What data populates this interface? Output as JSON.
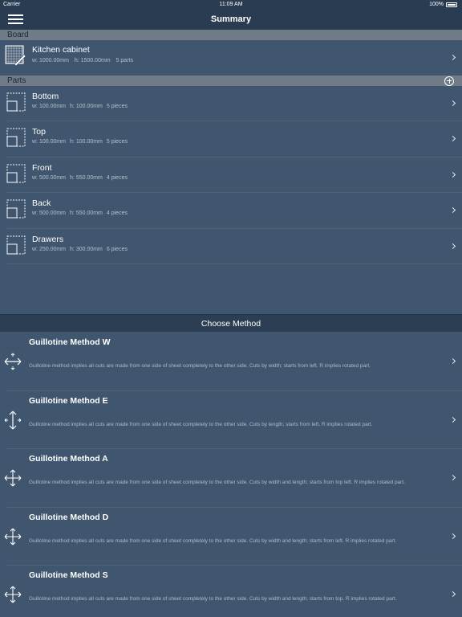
{
  "status": {
    "carrier": "Carrier",
    "time": "11:09 AM",
    "battery": "100%"
  },
  "nav": {
    "title": "Summary"
  },
  "board": {
    "header": "Board",
    "name": "Kitchen cabinet",
    "width": "w: 1000.00mm",
    "height": "h: 1500.00mm",
    "count": "5 parts"
  },
  "parts": {
    "header": "Parts",
    "items": [
      {
        "name": "Bottom",
        "width": "w: 100.00mm",
        "height": "h: 100.00mm",
        "count": "5 pieces"
      },
      {
        "name": "Top",
        "width": "w: 100.00mm",
        "height": "h: 100.00mm",
        "count": "5 pieces"
      },
      {
        "name": "Front",
        "width": "w: 500.00mm",
        "height": "h: 550.00mm",
        "count": "4 pieces"
      },
      {
        "name": "Back",
        "width": "w: 500.00mm",
        "height": "h: 550.00mm",
        "count": "4 pieces"
      },
      {
        "name": "Drawers",
        "width": "w: 250.00mm",
        "height": "h: 300.00mm",
        "count": "6 pieces"
      }
    ]
  },
  "methods": {
    "header": "Choose Method",
    "items": [
      {
        "name": "Guillotine Method W",
        "icon": "arrows-horizontal-icon",
        "desc": "Guillotine method implies all cuts are made from one side of sheet completely to the other side. Cuts by width; starts from left. R implies rotated part."
      },
      {
        "name": "Guillotine Method E",
        "icon": "arrows-vertical-icon",
        "desc": "Guillotine method implies all cuts are made from one side of sheet completely to the other side. Cuts by length; starts from left. R implies rotated part."
      },
      {
        "name": "Guillotine Method A",
        "icon": "arrows-all-icon",
        "desc": "Guillotine method implies all cuts are made from one side of sheet completely to the other side. Cuts by width and length; starts from top left. R implies rotated part."
      },
      {
        "name": "Guillotine Method D",
        "icon": "arrows-all-icon",
        "desc": "Guillotine method implies all cuts are made from one side of sheet completely to the other side. Cuts by width and length; starts from left. R implies rotated part."
      },
      {
        "name": "Guillotine Method S",
        "icon": "arrows-all-icon",
        "desc": "Guillotine method implies all cuts are made from one side of sheet completely to the other side. Cuts by width and length; starts from top. R implies rotated part."
      }
    ]
  },
  "colors": {
    "background": "#40566f",
    "navbar": "#2a3c51",
    "section": "#6f7c88"
  }
}
